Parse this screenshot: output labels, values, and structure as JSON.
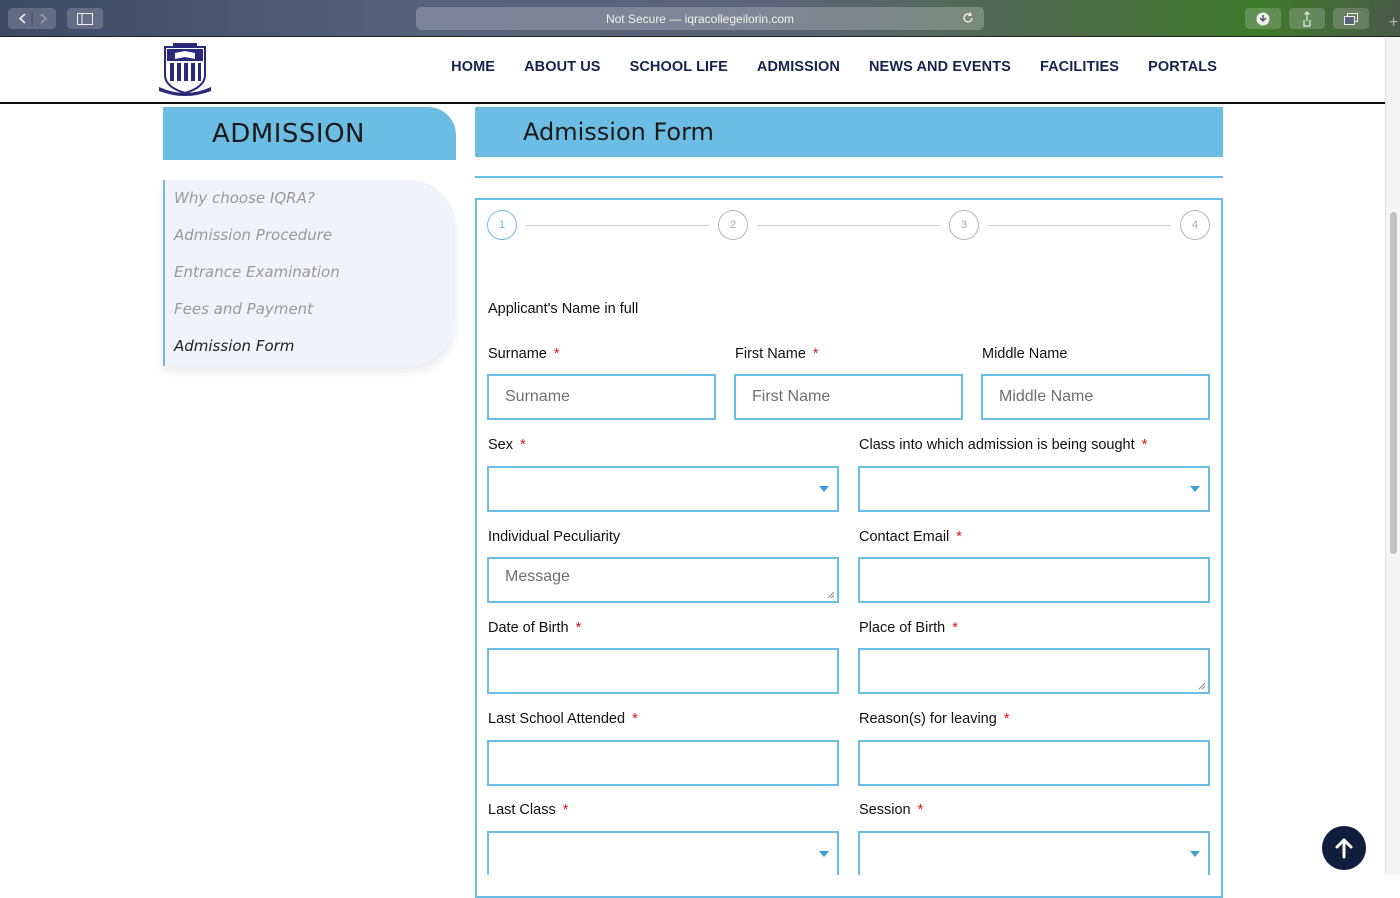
{
  "browser": {
    "address": "Not Secure — iqracollegeilorin.com"
  },
  "nav": [
    "HOME",
    "ABOUT US",
    "SCHOOL LIFE",
    "ADMISSION",
    "NEWS AND EVENTS",
    "FACILITIES",
    "PORTALS"
  ],
  "sidebar": {
    "title": "ADMISSION",
    "items": [
      "Why choose IQRA?",
      "Admission Procedure",
      "Entrance Examination",
      "Fees and Payment",
      "Admission Form"
    ]
  },
  "form": {
    "title": "Admission Form",
    "steps": [
      "1",
      "2",
      "3",
      "4"
    ],
    "section_label": "Applicant's Name in full",
    "required_mark": "*",
    "surname_label": "Surname",
    "surname_placeholder": "Surname",
    "first_name_label": "First Name",
    "first_name_placeholder": "First Name",
    "middle_name_label": "Middle Name",
    "middle_name_placeholder": "Middle Name",
    "sex_label": "Sex",
    "class_label": "Class into which admission is being sought",
    "peculiarity_label": "Individual Peculiarity",
    "peculiarity_placeholder": "Message",
    "email_label": "Contact Email",
    "dob_label": "Date of Birth",
    "pob_label": "Place of Birth",
    "last_school_label": "Last School Attended",
    "reasons_label": "Reason(s) for leaving",
    "last_class_label": "Last Class",
    "session_label": "Session"
  },
  "colors": {
    "accent": "#6cbde4",
    "nav_text": "#14244f",
    "required": "#e0101a",
    "to_top_button": "#0f1e3d"
  }
}
